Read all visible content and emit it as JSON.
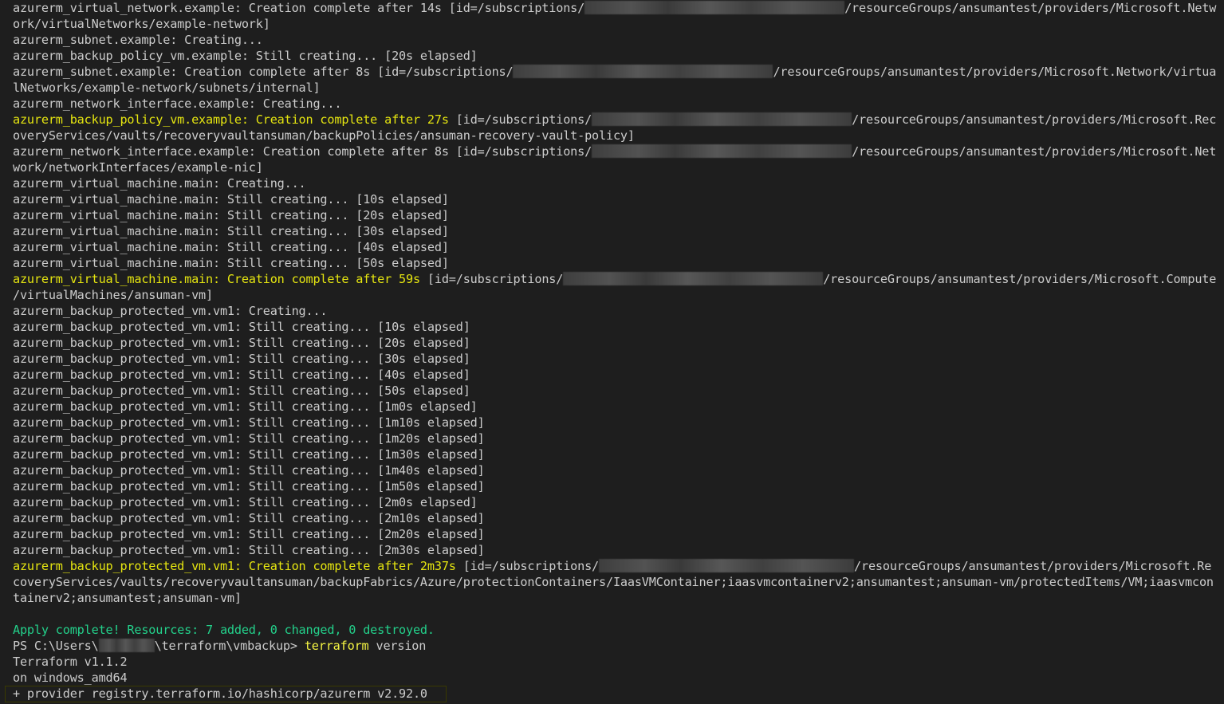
{
  "colors": {
    "background": "#1e1e1e",
    "text": "#cccccc",
    "success_yellow": "#e5e510",
    "apply_green": "#23d18b",
    "command_yellow": "#f5f543",
    "redaction_gray": "#4a4a4a"
  },
  "lines": [
    {
      "segments": [
        {
          "t": "text",
          "v": "azurerm_virtual_network.example: Creation complete after 14s [id=/subscriptions/"
        },
        {
          "t": "blur",
          "w": 326
        },
        {
          "t": "text",
          "v": "/resourceGroups/ansumantest/providers/Microsoft.Netw"
        }
      ]
    },
    {
      "segments": [
        {
          "t": "text",
          "v": "ork/virtualNetworks/example-network]"
        }
      ]
    },
    {
      "segments": [
        {
          "t": "text",
          "v": "azurerm_subnet.example: Creating..."
        }
      ]
    },
    {
      "segments": [
        {
          "t": "text",
          "v": "azurerm_backup_policy_vm.example: Still creating... [20s elapsed]"
        }
      ]
    },
    {
      "segments": [
        {
          "t": "text",
          "v": "azurerm_subnet.example: Creation complete after 8s [id=/subscriptions/"
        },
        {
          "t": "blur",
          "w": 326
        },
        {
          "t": "text",
          "v": "/resourceGroups/ansumantest/providers/Microsoft.Network/virtua"
        }
      ]
    },
    {
      "segments": [
        {
          "t": "text",
          "v": "lNetworks/example-network/subnets/internal]"
        }
      ]
    },
    {
      "segments": [
        {
          "t": "text",
          "v": "azurerm_network_interface.example: Creating..."
        }
      ]
    },
    {
      "segments": [
        {
          "t": "yellow",
          "v": "azurerm_backup_policy_vm.example: Creation complete after 27s"
        },
        {
          "t": "text",
          "v": " [id=/subscriptions/"
        },
        {
          "t": "blur",
          "w": 326
        },
        {
          "t": "text",
          "v": "/resourceGroups/ansumantest/providers/Microsoft.Rec"
        }
      ]
    },
    {
      "segments": [
        {
          "t": "text",
          "v": "overyServices/vaults/recoveryvaultansuman/backupPolicies/ansuman-recovery-vault-policy]"
        }
      ]
    },
    {
      "segments": [
        {
          "t": "text",
          "v": "azurerm_network_interface.example: Creation complete after 8s [id=/subscriptions/"
        },
        {
          "t": "blur",
          "w": 326
        },
        {
          "t": "text",
          "v": "/resourceGroups/ansumantest/providers/Microsoft.Net"
        }
      ]
    },
    {
      "segments": [
        {
          "t": "text",
          "v": "work/networkInterfaces/example-nic]"
        }
      ]
    },
    {
      "segments": [
        {
          "t": "text",
          "v": "azurerm_virtual_machine.main: Creating..."
        }
      ]
    },
    {
      "segments": [
        {
          "t": "text",
          "v": "azurerm_virtual_machine.main: Still creating... [10s elapsed]"
        }
      ]
    },
    {
      "segments": [
        {
          "t": "text",
          "v": "azurerm_virtual_machine.main: Still creating... [20s elapsed]"
        }
      ]
    },
    {
      "segments": [
        {
          "t": "text",
          "v": "azurerm_virtual_machine.main: Still creating... [30s elapsed]"
        }
      ]
    },
    {
      "segments": [
        {
          "t": "text",
          "v": "azurerm_virtual_machine.main: Still creating... [40s elapsed]"
        }
      ]
    },
    {
      "segments": [
        {
          "t": "text",
          "v": "azurerm_virtual_machine.main: Still creating... [50s elapsed]"
        }
      ]
    },
    {
      "segments": [
        {
          "t": "yellow",
          "v": "azurerm_virtual_machine.main: Creation complete after 59s"
        },
        {
          "t": "text",
          "v": " [id=/subscriptions/"
        },
        {
          "t": "blur",
          "w": 326
        },
        {
          "t": "text",
          "v": "/resourceGroups/ansumantest/providers/Microsoft.Compute"
        }
      ]
    },
    {
      "segments": [
        {
          "t": "text",
          "v": "/virtualMachines/ansuman-vm]"
        }
      ]
    },
    {
      "segments": [
        {
          "t": "text",
          "v": "azurerm_backup_protected_vm.vm1: Creating..."
        }
      ]
    },
    {
      "segments": [
        {
          "t": "text",
          "v": "azurerm_backup_protected_vm.vm1: Still creating... [10s elapsed]"
        }
      ]
    },
    {
      "segments": [
        {
          "t": "text",
          "v": "azurerm_backup_protected_vm.vm1: Still creating... [20s elapsed]"
        }
      ]
    },
    {
      "segments": [
        {
          "t": "text",
          "v": "azurerm_backup_protected_vm.vm1: Still creating... [30s elapsed]"
        }
      ]
    },
    {
      "segments": [
        {
          "t": "text",
          "v": "azurerm_backup_protected_vm.vm1: Still creating... [40s elapsed]"
        }
      ]
    },
    {
      "segments": [
        {
          "t": "text",
          "v": "azurerm_backup_protected_vm.vm1: Still creating... [50s elapsed]"
        }
      ]
    },
    {
      "segments": [
        {
          "t": "text",
          "v": "azurerm_backup_protected_vm.vm1: Still creating... [1m0s elapsed]"
        }
      ]
    },
    {
      "segments": [
        {
          "t": "text",
          "v": "azurerm_backup_protected_vm.vm1: Still creating... [1m10s elapsed]"
        }
      ]
    },
    {
      "segments": [
        {
          "t": "text",
          "v": "azurerm_backup_protected_vm.vm1: Still creating... [1m20s elapsed]"
        }
      ]
    },
    {
      "segments": [
        {
          "t": "text",
          "v": "azurerm_backup_protected_vm.vm1: Still creating... [1m30s elapsed]"
        }
      ]
    },
    {
      "segments": [
        {
          "t": "text",
          "v": "azurerm_backup_protected_vm.vm1: Still creating... [1m40s elapsed]"
        }
      ]
    },
    {
      "segments": [
        {
          "t": "text",
          "v": "azurerm_backup_protected_vm.vm1: Still creating... [1m50s elapsed]"
        }
      ]
    },
    {
      "segments": [
        {
          "t": "text",
          "v": "azurerm_backup_protected_vm.vm1: Still creating... [2m0s elapsed]"
        }
      ]
    },
    {
      "segments": [
        {
          "t": "text",
          "v": "azurerm_backup_protected_vm.vm1: Still creating... [2m10s elapsed]"
        }
      ]
    },
    {
      "segments": [
        {
          "t": "text",
          "v": "azurerm_backup_protected_vm.vm1: Still creating... [2m20s elapsed]"
        }
      ]
    },
    {
      "segments": [
        {
          "t": "text",
          "v": "azurerm_backup_protected_vm.vm1: Still creating... [2m30s elapsed]"
        }
      ]
    },
    {
      "segments": [
        {
          "t": "yellow",
          "v": "azurerm_backup_protected_vm.vm1: Creation complete after 2m37s"
        },
        {
          "t": "text",
          "v": " [id=/subscriptions/"
        },
        {
          "t": "blur",
          "w": 320
        },
        {
          "t": "text",
          "v": "/resourceGroups/ansumantest/providers/Microsoft.Re"
        }
      ]
    },
    {
      "segments": [
        {
          "t": "text",
          "v": "coveryServices/vaults/recoveryvaultansuman/backupFabrics/Azure/protectionContainers/IaasVMContainer;iaasvmcontainerv2;ansumantest;ansuman-vm/protectedItems/VM;iaasvmcon"
        }
      ]
    },
    {
      "segments": [
        {
          "t": "text",
          "v": "tainerv2;ansumantest;ansuman-vm]"
        }
      ]
    },
    {
      "segments": []
    },
    {
      "segments": [
        {
          "t": "green",
          "v": "Apply complete! Resources: 7 added, 0 changed, 0 destroyed."
        }
      ]
    },
    {
      "segments": [
        {
          "t": "text",
          "v": "PS C:\\Users\\"
        },
        {
          "t": "blur",
          "w": 70
        },
        {
          "t": "text",
          "v": "\\terraform\\vmbackup> "
        },
        {
          "t": "cmd",
          "v": "terraform"
        },
        {
          "t": "text",
          "v": " version"
        }
      ]
    },
    {
      "segments": [
        {
          "t": "text",
          "v": "Terraform v1.1.2"
        }
      ]
    },
    {
      "segments": [
        {
          "t": "text",
          "v": "on windows_amd64"
        }
      ]
    },
    {
      "segments": [
        {
          "t": "text",
          "v": "+ provider registry.terraform.io/hashicorp/azurerm v2.92.0"
        }
      ],
      "highlight": true
    }
  ]
}
